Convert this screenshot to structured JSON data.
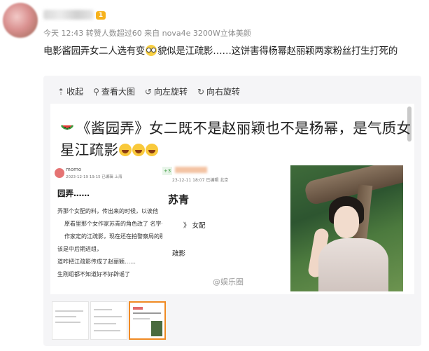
{
  "post": {
    "badge": "1",
    "meta": "今天 12:43 转赞人数超过60   来自 nova4e 3200W立体美颜",
    "text_before": "电影酱园弄女二人选有变",
    "text_after": "貌似是江疏影……这饼害得杨幂赵丽颖两家粉丝打生打死的"
  },
  "toolbar": {
    "collapse": "收起",
    "view_large": "查看大图",
    "rotate_left": "向左旋转",
    "rotate_right": "向右旋转"
  },
  "image": {
    "headline": "《酱园弄》女二既不是赵丽颖也不是杨幂，是气质女星江疏影",
    "left_shot": {
      "app": "momo",
      "date": "2023-12-19 19:15  已编辑 上海",
      "title": "园弄……",
      "lines": [
        "弄那个女配的料，传出来的时候，以诶他",
        "原看里那个女作家苏青的角色改了 名字也",
        "作家定的江疏影，现在还在拍警察局的那",
        "该是中后期进组，",
        "道咋把江疏影传成了赵丽颖……",
        "生刚组都不知道好不好辟谣了"
      ]
    },
    "mid_shot": {
      "badge": "+3",
      "date": "23-12-11 18:07 已编辑 北京",
      "name": "苏青",
      "line1": "》 女配",
      "line2": "疏影"
    },
    "watermark": "@娱乐圈"
  },
  "thumbnails": [
    {
      "id": "thumb-1",
      "active": false
    },
    {
      "id": "thumb-2",
      "active": false
    },
    {
      "id": "thumb-3",
      "active": true
    },
    {
      "id": "thumb-4",
      "active": false
    }
  ],
  "colors": {
    "accent_orange": "#f08a24",
    "meta_gray": "#8c8c8c",
    "card_bg": "#f5f5f7"
  }
}
